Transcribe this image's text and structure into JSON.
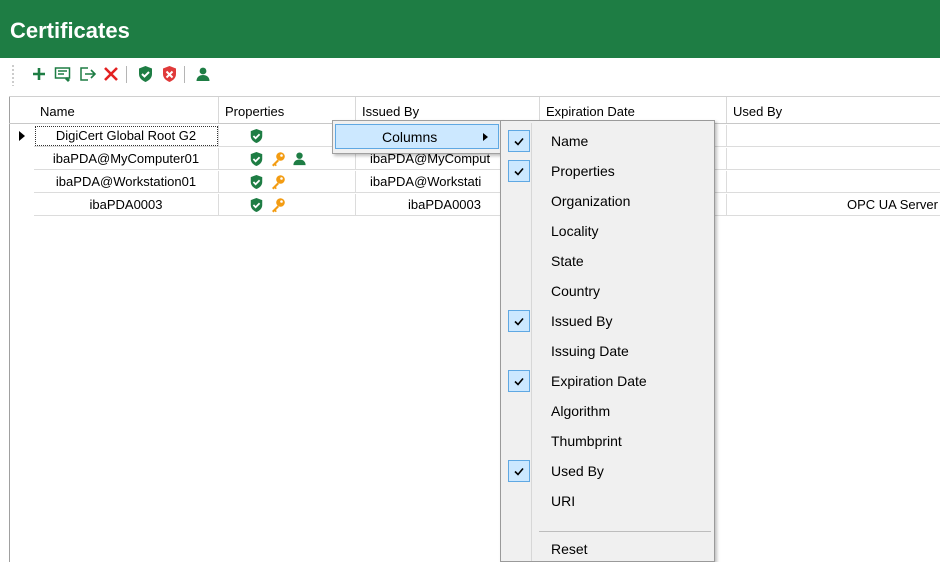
{
  "window": {
    "title": "Certificates",
    "accent_color": "#1e7d44"
  },
  "toolbar": {
    "buttons": [
      {
        "icon": "plus-icon",
        "color": "#1e7d44"
      },
      {
        "icon": "edit-certificate-icon",
        "color": "#1e7d44"
      },
      {
        "icon": "export-icon",
        "color": "#1e7d44"
      },
      {
        "icon": "delete-x-icon",
        "color": "#e32222"
      },
      {
        "icon": "trusted-shield-icon",
        "color": "#1e7d44"
      },
      {
        "icon": "rejected-shield-icon",
        "color": "#e03a3a"
      },
      {
        "icon": "user-icon",
        "color": "#1e7d44"
      }
    ]
  },
  "table": {
    "columns": [
      "Name",
      "Properties",
      "Issued By",
      "Expiration Date",
      "Used By"
    ],
    "rows": [
      {
        "name": "DigiCert Global Root G2",
        "properties": [
          "shield"
        ],
        "issued_by": "",
        "expiration": "",
        "used_by": "",
        "selected": true
      },
      {
        "name": "ibaPDA@MyComputer01",
        "properties": [
          "shield",
          "key",
          "user"
        ],
        "issued_by": "ibaPDA@MyComput",
        "expiration": "",
        "used_by": ""
      },
      {
        "name": "ibaPDA@Workstation01",
        "properties": [
          "shield",
          "key"
        ],
        "issued_by": "ibaPDA@Workstati",
        "expiration": "",
        "used_by": ""
      },
      {
        "name": "ibaPDA0003",
        "properties": [
          "shield",
          "key"
        ],
        "issued_by": "ibaPDA0003",
        "expiration": "",
        "used_by": "OPC UA Server"
      }
    ]
  },
  "context_menu": {
    "label": "Columns",
    "submenu": [
      {
        "label": "Name",
        "checked": true
      },
      {
        "label": "Properties",
        "checked": true
      },
      {
        "label": "Organization",
        "checked": false
      },
      {
        "label": "Locality",
        "checked": false
      },
      {
        "label": "State",
        "checked": false
      },
      {
        "label": "Country",
        "checked": false
      },
      {
        "label": "Issued By",
        "checked": true
      },
      {
        "label": "Issuing Date",
        "checked": false
      },
      {
        "label": "Expiration Date",
        "checked": true
      },
      {
        "label": "Algorithm",
        "checked": false
      },
      {
        "label": "Thumbprint",
        "checked": false
      },
      {
        "label": "Used By",
        "checked": true
      },
      {
        "label": "URI",
        "checked": false
      },
      {
        "label": "Reset",
        "checked": false
      }
    ]
  }
}
